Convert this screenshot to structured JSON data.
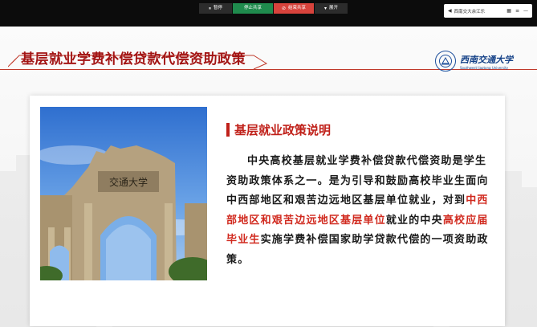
{
  "toolbar": {
    "pause_label": "暂停",
    "stop_share_label": "停止共享",
    "stop_label": "结束共享",
    "expand_label": "展开"
  },
  "presenter": {
    "name": "西南交大余江乐"
  },
  "slide": {
    "title": "基层就业学费补偿贷款代偿资助政策",
    "logo": {
      "cn": "西南交通大学",
      "en": "Southwest Jiaotong University"
    },
    "section_title": "基层就业政策说明",
    "paragraph": {
      "part1": "中央高校基层就业学费补偿贷款代偿资助是学生资助政策体系之一。是为引导和鼓励高校毕业生面向中西部地区和艰苦边远地区基层单位就业，对到",
      "highlight1": "中西部地区和艰苦边远地区基层单位",
      "part2": "就业的中央",
      "highlight2": "高校应届毕业生",
      "part3": "实施学费补偿国家助学贷款代偿的一项资助政策。"
    },
    "photo_sign": "交通大学"
  },
  "colors": {
    "accent_red": "#c0211a",
    "title_red": "#a31515",
    "logo_blue": "#123f86"
  }
}
